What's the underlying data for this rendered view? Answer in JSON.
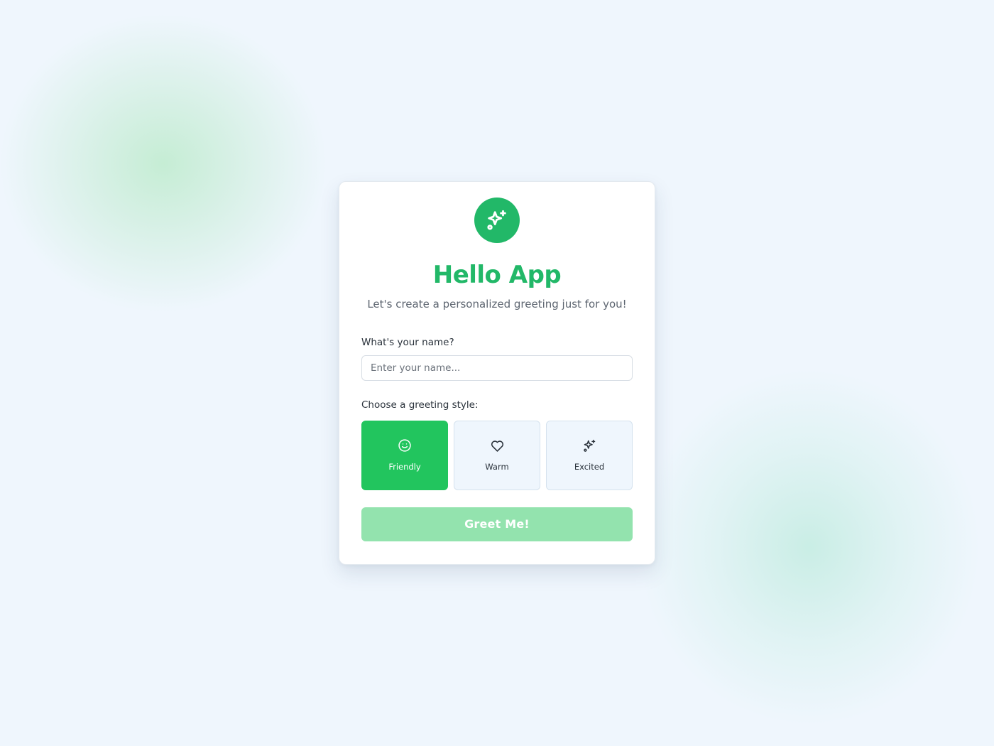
{
  "app": {
    "title": "Hello App",
    "subtitle": "Let's create a personalized greeting just for you!",
    "logo_icon": "sparkles-icon"
  },
  "form": {
    "name_label": "What's your name?",
    "name_value": "",
    "name_placeholder": "Enter your name...",
    "style_label": "Choose a greeting style:",
    "styles": [
      {
        "label": "Friendly",
        "icon": "smile-icon",
        "selected": true
      },
      {
        "label": "Warm",
        "icon": "heart-icon",
        "selected": false
      },
      {
        "label": "Excited",
        "icon": "sparkles-icon",
        "selected": false
      }
    ],
    "submit_label": "Greet Me!",
    "submit_enabled": false
  },
  "colors": {
    "brand_green": "#22b868",
    "selected_green": "#22c55e",
    "disabled_button": "#93e3ae",
    "page_background": "#eff6fd"
  }
}
